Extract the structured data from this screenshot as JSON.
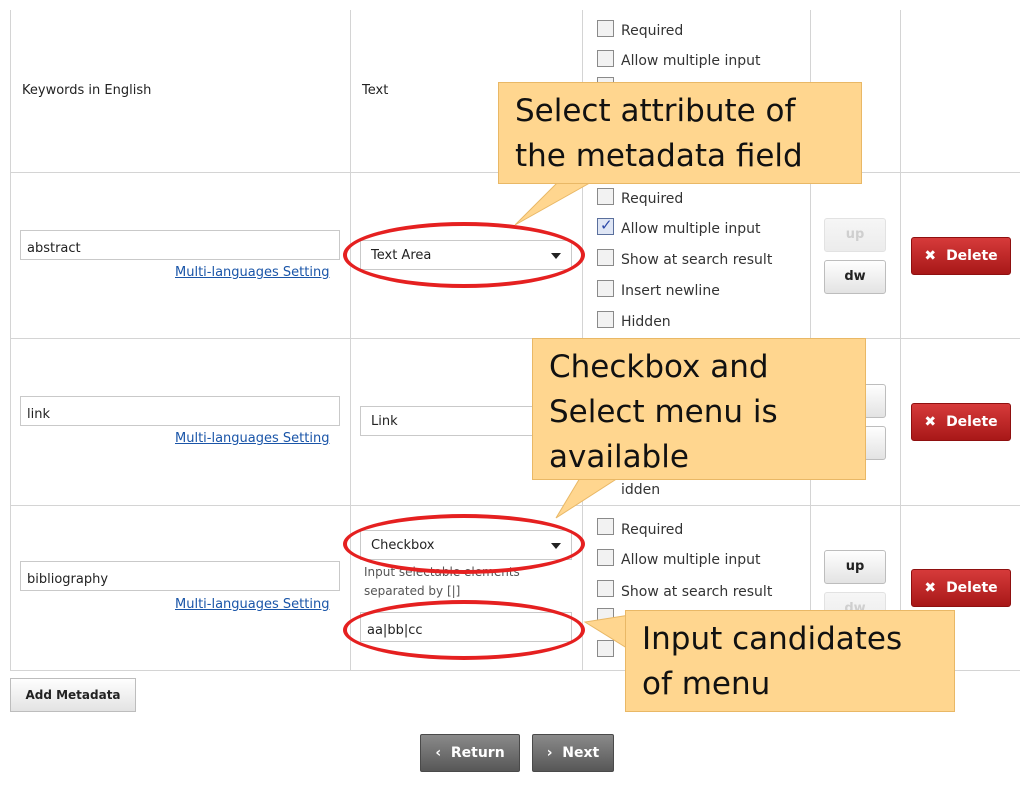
{
  "header_row": {
    "field_name": "Keywords in English",
    "input_type": "Text",
    "options": [
      "Required",
      "Allow multiple input"
    ]
  },
  "rows": [
    {
      "field_name": "abstract",
      "multi_lang_link": "Multi-languages Setting",
      "input_type": "Text Area",
      "options": [
        {
          "label": "Required",
          "checked": false
        },
        {
          "label": "Allow multiple input",
          "checked": true
        },
        {
          "label": "Show at search result",
          "checked": false
        },
        {
          "label": "Insert newline",
          "checked": false
        },
        {
          "label": "Hidden",
          "checked": false
        }
      ],
      "up_label": "up",
      "dw_label": "dw",
      "up_enabled": false,
      "dw_enabled": true,
      "delete_label": "Delete"
    },
    {
      "field_name": "link",
      "multi_lang_link": "Multi-languages Setting",
      "input_type": "Link",
      "options_visible": [
        "idden"
      ],
      "delete_label": "Delete"
    },
    {
      "field_name": "bibliography",
      "multi_lang_link": "Multi-languages Setting",
      "input_type": "Checkbox",
      "candidates_hint_line1": "Input selectable elements",
      "candidates_hint_line2": "separated by [|]",
      "candidates_value": "aa|bb|cc",
      "options": [
        {
          "label": "Required",
          "checked": false
        },
        {
          "label": "Allow multiple input",
          "checked": false
        },
        {
          "label": "Show at search result",
          "checked": false
        }
      ],
      "up_label": "up",
      "dw_label": "dw",
      "up_enabled": true,
      "dw_enabled": false,
      "delete_label": "Delete"
    }
  ],
  "add_metadata_label": "Add Metadata",
  "return_label": "Return",
  "next_label": "Next",
  "callouts": {
    "attribute": [
      "Select attribute of",
      "the metadata field"
    ],
    "checkbox": [
      "Checkbox and",
      "Select menu is",
      "available"
    ],
    "candidates": [
      "Input candidates",
      "of menu"
    ]
  },
  "colors": {
    "callout_fill": "#ffd68f",
    "highlight_ellipse": "#e52020",
    "delete_button": "#b82020",
    "link": "#1a55a8"
  }
}
